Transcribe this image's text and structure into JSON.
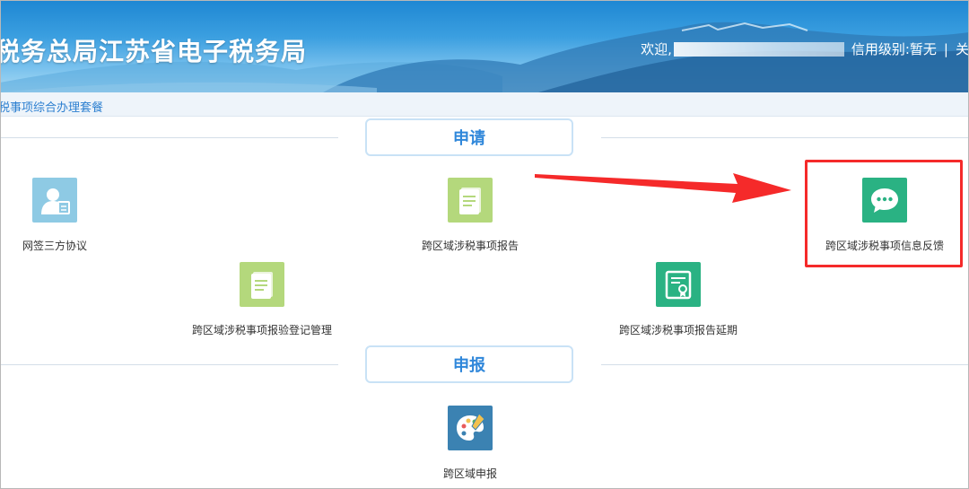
{
  "header": {
    "site_title": "税务总局江苏省电子税务局",
    "welcome": "欢迎,",
    "credit_label": "信用级别:暂无",
    "separator": "|",
    "close_partial": "关"
  },
  "breadcrumb": "税事项综合办理套餐",
  "sections": {
    "apply": {
      "title": "申请"
    },
    "declare": {
      "title": "申报"
    }
  },
  "tiles": {
    "third_party_agreement": {
      "label": "网签三方协议",
      "icon": "user-card-icon",
      "color": "#8ecae4"
    },
    "cross_region_report": {
      "label": "跨区域涉税事项报告",
      "icon": "document-icon",
      "color": "#b4d87c"
    },
    "cross_region_feedback": {
      "label": "跨区域涉税事项信息反馈",
      "icon": "chat-bubble-icon",
      "color": "#2ab283"
    },
    "cross_region_verification": {
      "label": "跨区域涉税事项报验登记管理",
      "icon": "document-icon",
      "color": "#b4d87c"
    },
    "cross_region_extension": {
      "label": "跨区域涉税事项报告延期",
      "icon": "certificate-icon",
      "color": "#2ab283"
    },
    "cross_region_declaration": {
      "label": "跨区域申报",
      "icon": "palette-icon",
      "color": "#3b82b2"
    }
  },
  "annotation": {
    "highlight_color": "#f52a2a"
  }
}
